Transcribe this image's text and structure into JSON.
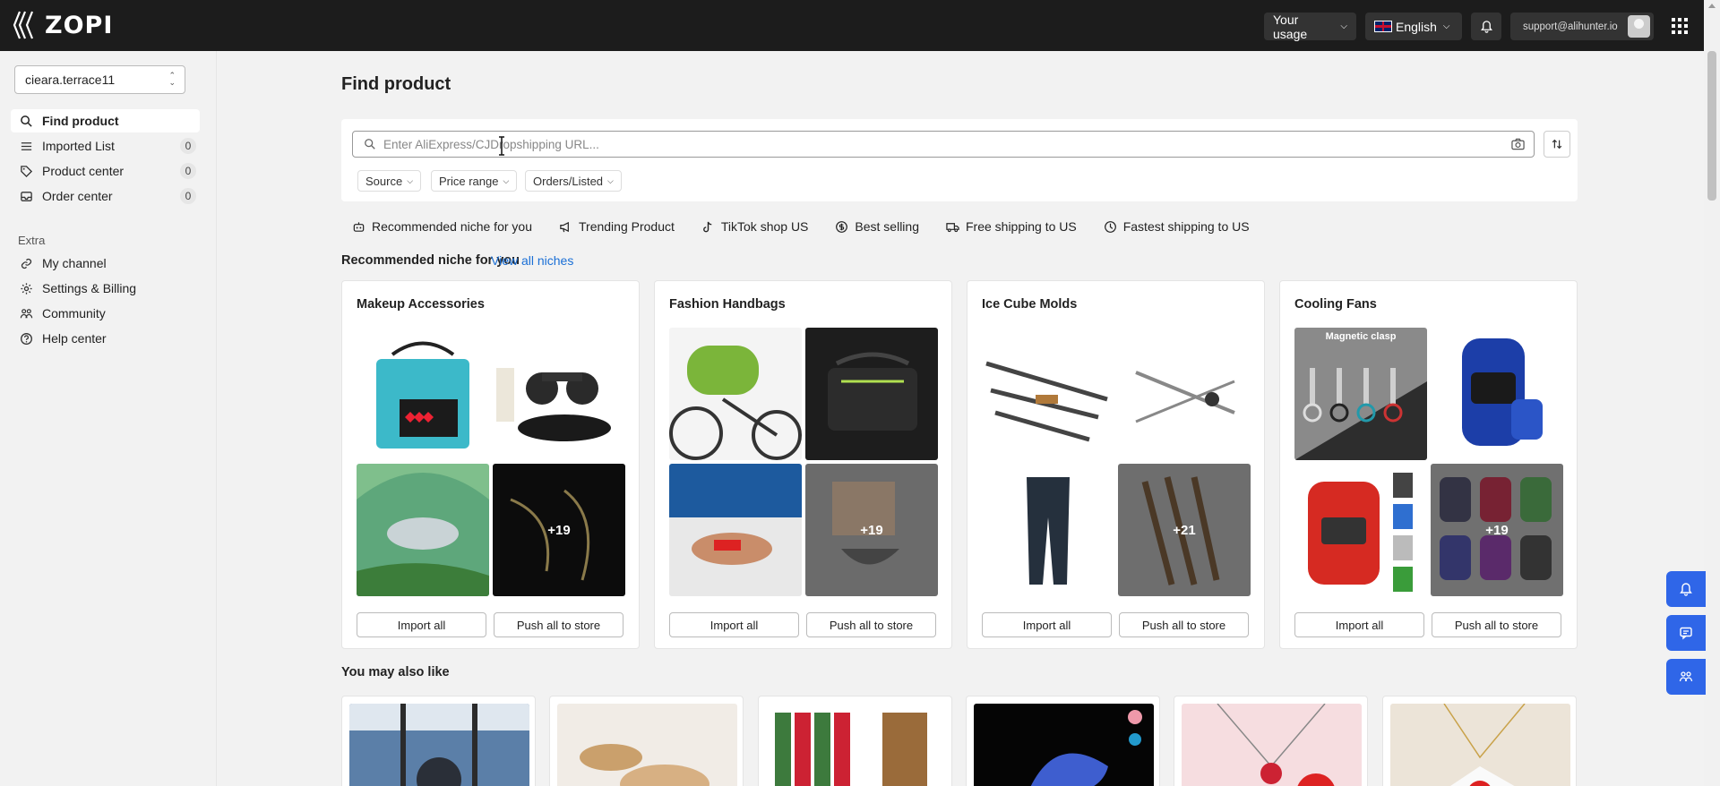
{
  "app": {
    "name": "ZOPI"
  },
  "header": {
    "usage_label": "Your usage",
    "language_label": "English",
    "account_email": "support@alihunter.io"
  },
  "sidebar": {
    "store": "cieara.terrace11",
    "items": [
      {
        "label": "Find product",
        "icon": "search-icon",
        "active": true
      },
      {
        "label": "Imported List",
        "icon": "list-icon",
        "count": "0"
      },
      {
        "label": "Product center",
        "icon": "tag-icon",
        "count": "0"
      },
      {
        "label": "Order center",
        "icon": "inbox-icon",
        "count": "0"
      }
    ],
    "extra_label": "Extra",
    "extra_items": [
      {
        "label": "My channel",
        "icon": "link-icon"
      },
      {
        "label": "Settings & Billing",
        "icon": "gear-icon"
      },
      {
        "label": "Community",
        "icon": "community-icon"
      },
      {
        "label": "Help center",
        "icon": "help-icon"
      }
    ]
  },
  "main": {
    "title": "Find product",
    "search": {
      "placeholder": "Enter AliExpress/CJDropshipping URL...",
      "value": ""
    },
    "filters": [
      "Source",
      "Price range",
      "Orders/Listed"
    ],
    "tabs": [
      {
        "label": "Recommended niche for you",
        "icon": "robot-icon"
      },
      {
        "label": "Trending Product",
        "icon": "megaphone-icon"
      },
      {
        "label": "TikTok shop US",
        "icon": "tiktok-icon"
      },
      {
        "label": "Best selling",
        "icon": "dollar-icon"
      },
      {
        "label": "Free shipping to US",
        "icon": "truck-icon"
      },
      {
        "label": "Fastest shipping to US",
        "icon": "clock-icon"
      }
    ],
    "niche_section_title": "Recommended niche for you",
    "view_all_label": "View all niches",
    "niches": [
      {
        "title": "Makeup Accessories",
        "more": "+19",
        "import_label": "Import all",
        "push_label": "Push all to store"
      },
      {
        "title": "Fashion Handbags",
        "more": "+19",
        "import_label": "Import all",
        "push_label": "Push all to store"
      },
      {
        "title": "Ice Cube Molds",
        "more": "+21",
        "import_label": "Import all",
        "push_label": "Push all to store"
      },
      {
        "title": "Cooling Fans",
        "more": "+19",
        "import_label": "Import all",
        "push_label": "Push all to store",
        "thumb_caption": "Magnetic clasp"
      }
    ],
    "also_like_title": "You may also like"
  },
  "colors": {
    "topbar": "#1c1c1c",
    "accent": "#2f66e8",
    "link": "#1a6fd6"
  }
}
